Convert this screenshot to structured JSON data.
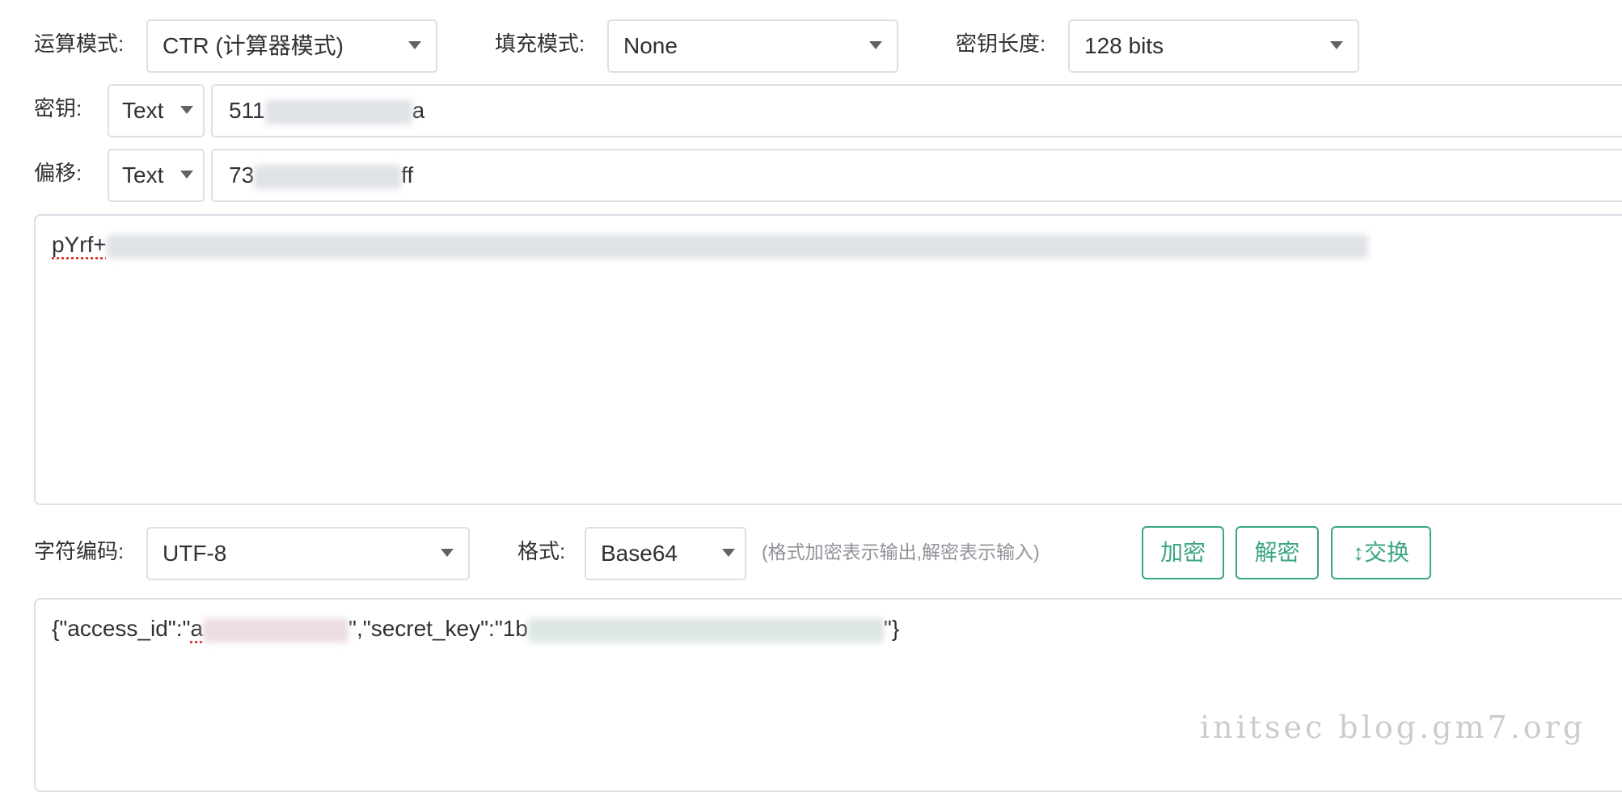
{
  "form": {
    "mode": {
      "label": "运算模式:",
      "value": "CTR (计算器模式)"
    },
    "padding": {
      "label": "填充模式:",
      "value": "None"
    },
    "key_length": {
      "label": "密钥长度:",
      "value": "128 bits"
    },
    "key": {
      "label": "密钥:",
      "type": "Text",
      "value_start": "511",
      "value_end": "a"
    },
    "offset": {
      "label": "偏移:",
      "type": "Text",
      "value_start": "73",
      "value_end": "ff"
    }
  },
  "input_area": {
    "text_start": "pYrf+"
  },
  "encoding": {
    "charset": {
      "label": "字符编码:",
      "value": "UTF-8"
    },
    "format": {
      "label": "格式:",
      "value": "Base64"
    },
    "hint": "(格式加密表示输出,解密表示输入)"
  },
  "actions": {
    "encrypt": "加密",
    "decrypt": "解密",
    "swap_icon": "↕",
    "swap": "交换"
  },
  "output_area": {
    "part1": "{\"access_id\":\"",
    "part1_char": "a",
    "part2": "\",\"secret_key\":\"1",
    "part2_char": "b",
    "part3": "\"}"
  },
  "watermark": "initsec blog.gm7.org",
  "icons": {
    "dropdown": "chevron-down-icon",
    "swap": "swap-vertical-icon"
  },
  "colors": {
    "accent": "#3aa67d",
    "border": "#dcdfe6",
    "text": "#303133",
    "hint": "#909399"
  }
}
